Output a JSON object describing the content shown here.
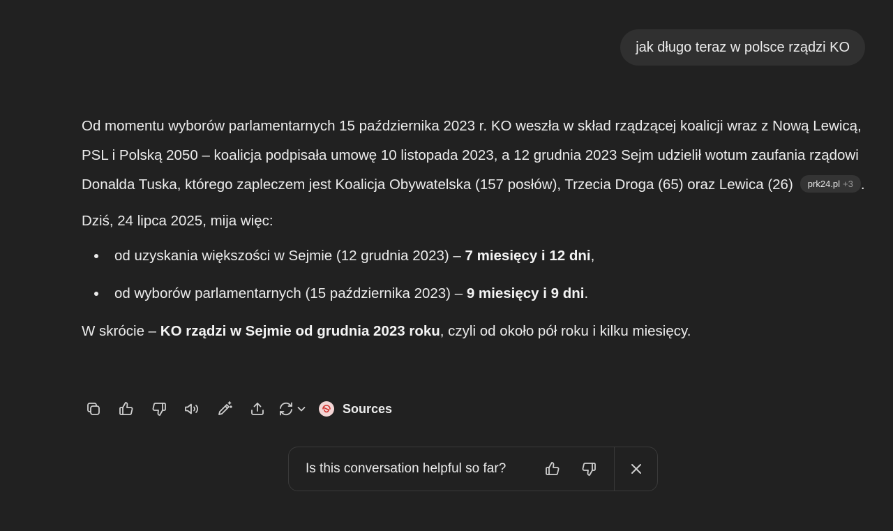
{
  "user_message": "jak długo teraz w polsce rządzi KO",
  "assistant": {
    "para1": "Od momentu wyborów parlamentarnych 15 października 2023 r. KO weszła w skład rządzącej koalicji wraz z Nową Lewicą, PSL i Polską 2050 – koalicja podpisała umowę 10 listopada 2023, a 12 grudnia 2023 Sejm udzielił wotum zaufania rządowi Donalda Tuska, którego zapleczem jest Koalicja Obywatelska (157 posłów), Trzecia Droga (65) oraz Lewica (26)",
    "para1_end": ".",
    "citation": {
      "source": "prk24.pl",
      "more": "+3"
    },
    "para2": "Dziś, 24 lipca 2025, mija więc:",
    "bullets": [
      {
        "prefix": "od uzyskania większości w Sejmie (12 grudnia 2023) – ",
        "bold": "7 miesięcy i 12 dni",
        "suffix": ","
      },
      {
        "prefix": "od wyborów parlamentarnych (15 października 2023) – ",
        "bold": "9 miesięcy i 9 dni",
        "suffix": "."
      }
    ],
    "summary": {
      "prefix": "W skrócie – ",
      "bold": "KO rządzi w Sejmie od grudnia 2023 roku",
      "suffix": ", czyli od około pół roku i kilku miesięcy."
    }
  },
  "actions": {
    "copy_icon": "copy-icon",
    "thumbs_up_icon": "thumbs-up-icon",
    "thumbs_down_icon": "thumbs-down-icon",
    "read_aloud_icon": "speaker-icon",
    "edit_icon": "magic-pencil-icon",
    "share_icon": "share-icon",
    "regenerate_icon": "refresh-icon",
    "sources_label": "Sources"
  },
  "feedback": {
    "question": "Is this conversation helpful so far?"
  },
  "colors": {
    "background": "#212121",
    "user_bubble": "#303030",
    "text": "#ececec",
    "citation_bg": "#343434"
  }
}
